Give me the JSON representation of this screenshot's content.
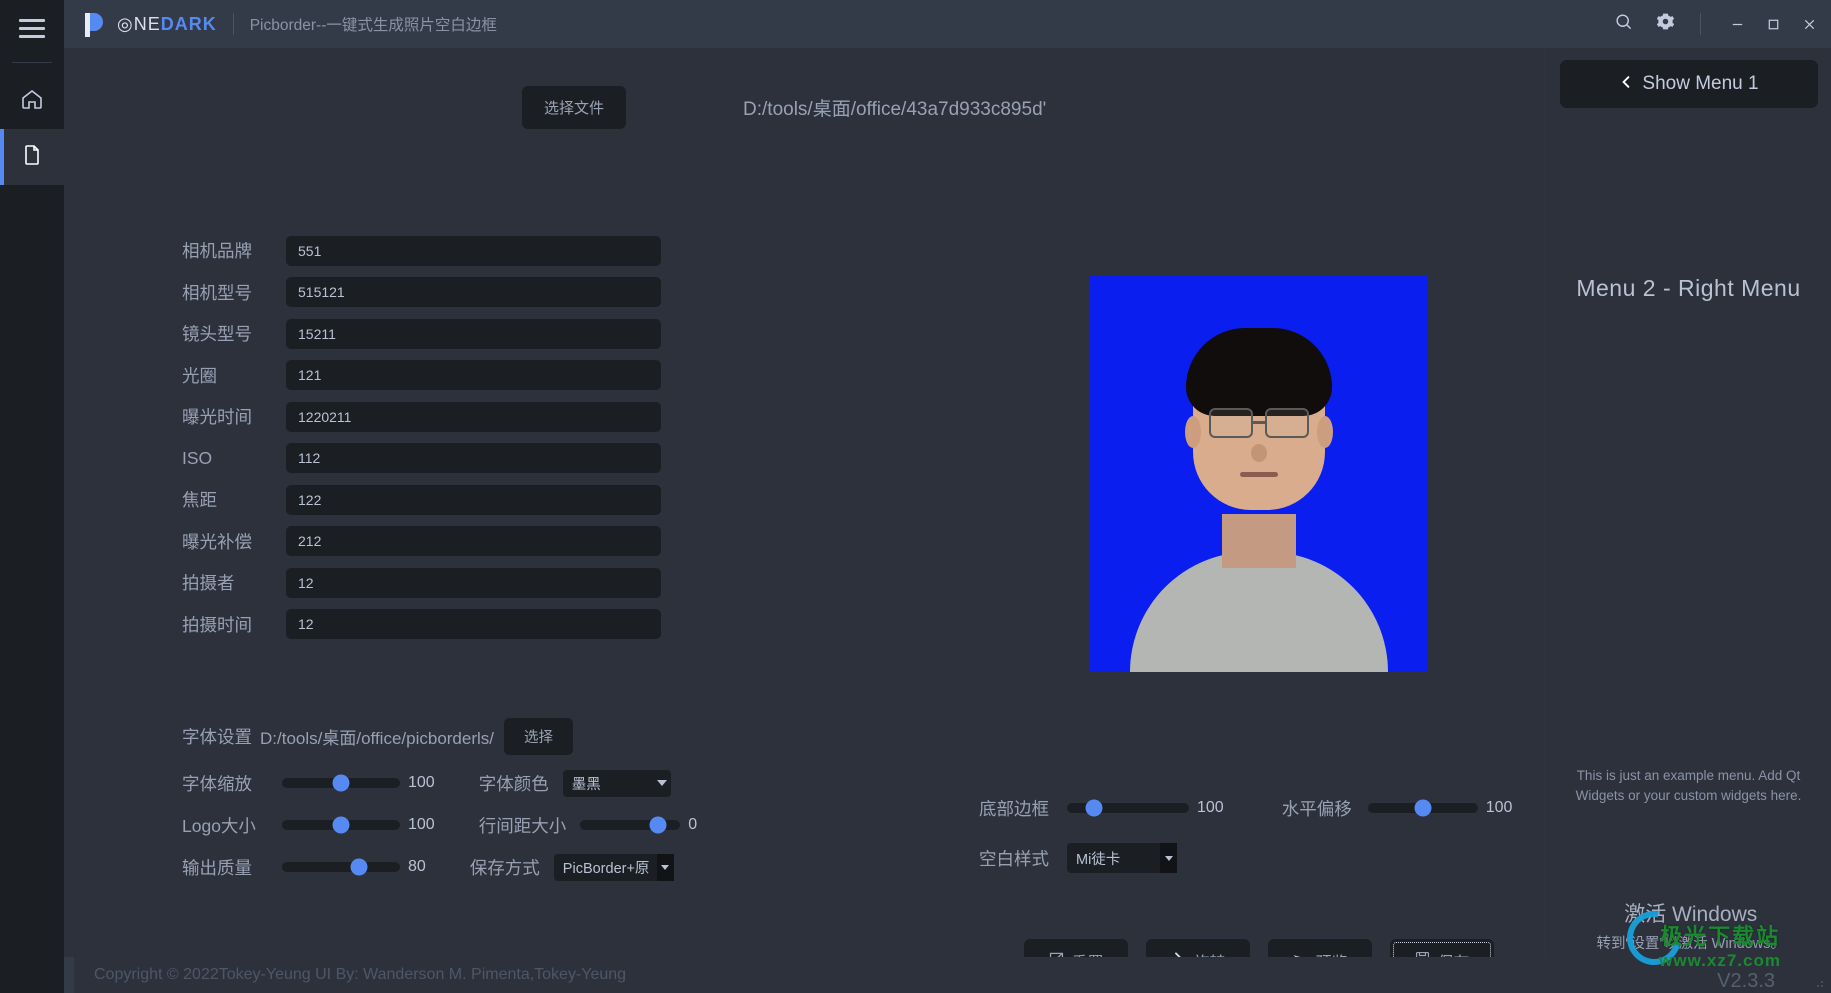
{
  "titlebar": {
    "brand_one": "◎NE",
    "brand_dark": "DARK",
    "app_description": "Picborder--一键式生成照片空白边框",
    "search_icon": "search-icon",
    "settings_icon": "gear-icon",
    "minimize": "–",
    "maximize": "□",
    "close": "✕"
  },
  "left_rail": {
    "menu_icon": "hamburger-icon",
    "items": [
      {
        "icon": "home-icon",
        "name": "home"
      },
      {
        "icon": "file-icon",
        "name": "file",
        "active": true
      }
    ]
  },
  "file_picker": {
    "choose_button": "选择文件",
    "path": "D:/tools/桌面/office/43a7d933c895d'"
  },
  "exif_form": {
    "fields": [
      {
        "label": "相机品牌",
        "value": "551"
      },
      {
        "label": "相机型号",
        "value": "515121"
      },
      {
        "label": "镜头型号",
        "value": "15211"
      },
      {
        "label": "光圈",
        "value": "121"
      },
      {
        "label": "曝光时间",
        "value": "1220211"
      },
      {
        "label": "ISO",
        "value": "112"
      },
      {
        "label": "焦距",
        "value": "122"
      },
      {
        "label": "曝光补偿",
        "value": "212"
      },
      {
        "label": "拍摄者",
        "value": "12"
      },
      {
        "label": "拍摄时间",
        "value": "12"
      }
    ]
  },
  "font_settings": {
    "label": "字体设置",
    "path": "D:/tools/桌面/office/picborderls/",
    "select_button": "选择",
    "font_scale": {
      "label": "字体缩放",
      "value": "100",
      "percent": 50
    },
    "logo_size": {
      "label": "Logo大小",
      "value": "100",
      "percent": 50
    },
    "output_quality": {
      "label": "输出质量",
      "value": "80",
      "percent": 65
    },
    "font_color": {
      "label": "字体颜色",
      "value": "墨黑"
    },
    "line_spacing": {
      "label": "行间距大小",
      "value": "0",
      "percent": 78
    },
    "save_mode": {
      "label": "保存方式",
      "value": "PicBorder+原"
    }
  },
  "border_settings": {
    "bottom_border": {
      "label": "底部边框",
      "value": "100",
      "percent": 22
    },
    "horizontal_offset": {
      "label": "水平偏移",
      "value": "100",
      "percent": 50
    },
    "blank_style": {
      "label": "空白样式",
      "value": "Mi徒卡"
    }
  },
  "actions": [
    {
      "label": "重置",
      "icon": "reset-icon",
      "focused": false
    },
    {
      "label": "旋转",
      "icon": "rotate-icon",
      "focused": false
    },
    {
      "label": "预览",
      "icon": "preview-icon",
      "focused": false
    },
    {
      "label": "保存",
      "icon": "save-icon",
      "focused": true
    }
  ],
  "right_menu": {
    "show_menu_button": "Show Menu 1",
    "chevron": "‹",
    "title": "Menu 2 - Right Menu",
    "note": "This is just an example menu. Add Qt Widgets or your custom widgets here."
  },
  "footer": {
    "copyright": "Copyright © 2022Tokey-Yeung   UI By: Wanderson M. Pimenta,Tokey-Yeung"
  },
  "watermarks": {
    "windows_line1": "激活 Windows",
    "windows_line2": "转到“设置”以激活 Windows。",
    "site_cn": "极光下载站",
    "site_url": "www.xz7.com",
    "version": "V2.3.3"
  },
  "colors": {
    "accent": "#568af2",
    "bg": "#2c313c",
    "panel": "#343b48",
    "dark": "#1b1e23",
    "text": "#98a1b3"
  }
}
